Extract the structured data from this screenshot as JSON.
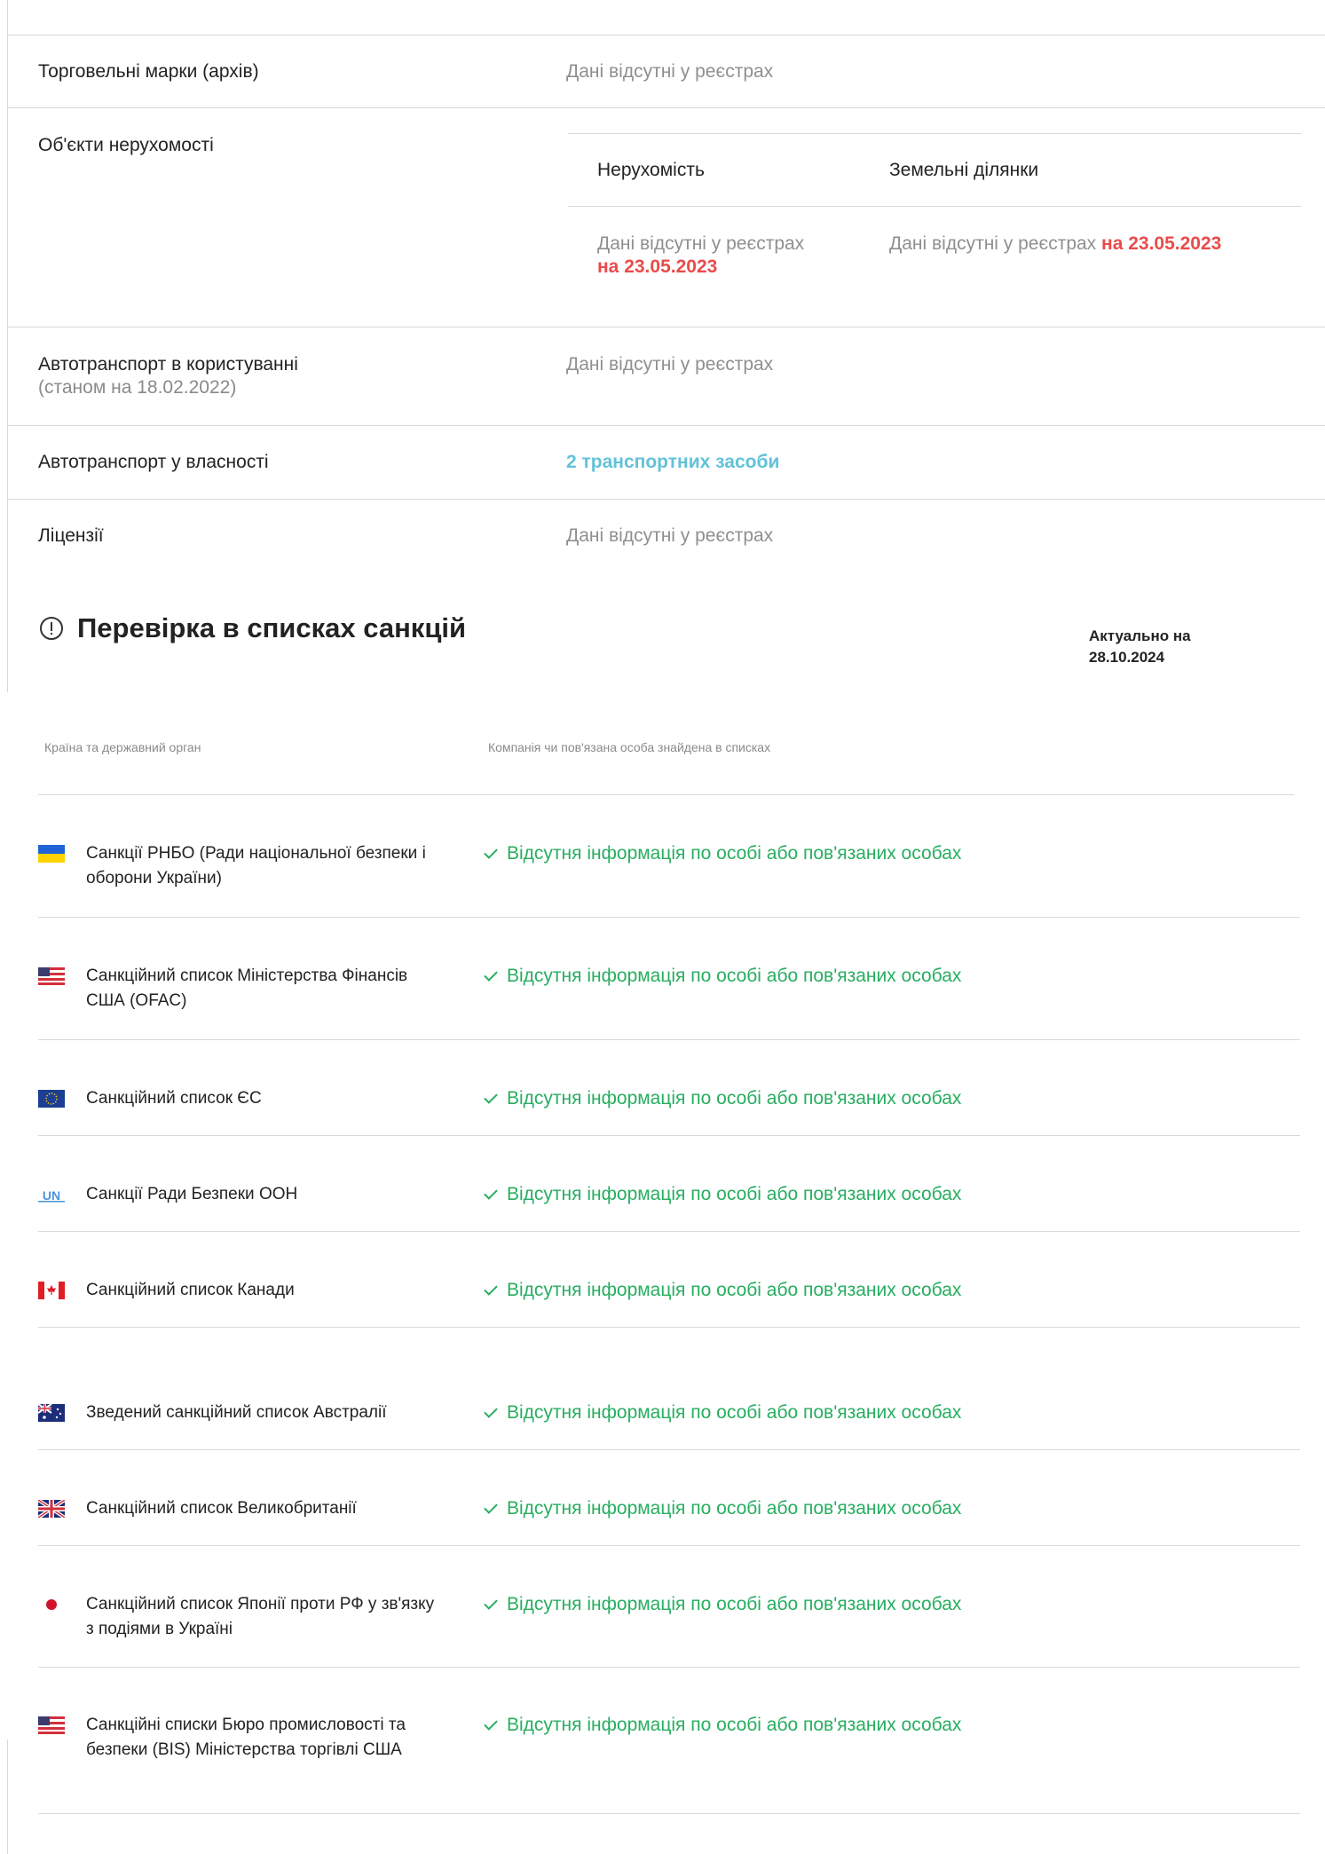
{
  "registry": {
    "rows": [
      {
        "label": "Торговельні марки (архів)",
        "value": "Дані відсутні у реєстрах"
      },
      {
        "label": "Об'єкти нерухомості"
      },
      {
        "label": "Автотранспорт в користуванні",
        "sublabel": "(станом на 18.02.2022)",
        "value": "Дані відсутні у реєстрах"
      },
      {
        "label": "Автотранспорт у власності",
        "link": "2 транспортних засоби"
      },
      {
        "label": "Ліцензії",
        "value": "Дані відсутні у реєстрах"
      }
    ],
    "property": {
      "col1_head": "Нерухомість",
      "col2_head": "Земельні ділянки",
      "col1_value": "Дані відсутні у реєстрах",
      "col1_date": "на 23.05.2023",
      "col2_value": "Дані відсутні у реєстрах",
      "col2_date": "на 23.05.2023"
    }
  },
  "sanctions": {
    "title": "Перевірка в списках санкцій",
    "actual_label": "Актуально на",
    "actual_date": "28.10.2024",
    "col1_head": "Країна та державний орган",
    "col2_head": "Компанія чи пов'язана особа знайдена в списках",
    "rows": [
      {
        "flag": "ukraine-flag-icon",
        "name": "Санкції РНБО (Ради національної безпеки і оборони України)",
        "result": "Відсутня інформація по особі або пов'язаних особах"
      },
      {
        "flag": "usa-flag-icon",
        "name": "Санкційний список Міністерства Фінансів США (OFAC)",
        "result": "Відсутня інформація по особі або пов'язаних особах"
      },
      {
        "flag": "eu-flag-icon",
        "name": "Санкційний список ЄС",
        "result": "Відсутня інформація по особі або пов'язаних особах"
      },
      {
        "flag": "un-flag-icon",
        "name": "Санкції Ради Безпеки ООН",
        "result": "Відсутня інформація по особі або пов'язаних особах"
      },
      {
        "flag": "canada-flag-icon",
        "name": "Санкційний список Канади",
        "result": "Відсутня інформація по особі або пов'язаних особах"
      },
      {
        "flag": "australia-flag-icon",
        "name": "Зведений санкційний список Австралії",
        "result": "Відсутня інформація по особі або пов'язаних особах"
      },
      {
        "flag": "uk-flag-icon",
        "name": "Санкційний список Великобританії",
        "result": "Відсутня інформація по особі або пов'язаних особах"
      },
      {
        "flag": "japan-flag-icon",
        "name": "Санкційний список Японії проти РФ у зв'язку з подіями в Україні",
        "result": "Відсутня інформація по особі або пов'язаних особах"
      },
      {
        "flag": "usa-flag-icon",
        "name": "Санкційні списки Бюро промисловості та безпеки (BIS) Міністерства торгівлі США",
        "result": "Відсутня інформація по особі або пов'язаних особах"
      }
    ]
  },
  "colors": {
    "success": "#27ae60",
    "accent_link": "#62c2d8",
    "alert": "#ea4b4b"
  }
}
